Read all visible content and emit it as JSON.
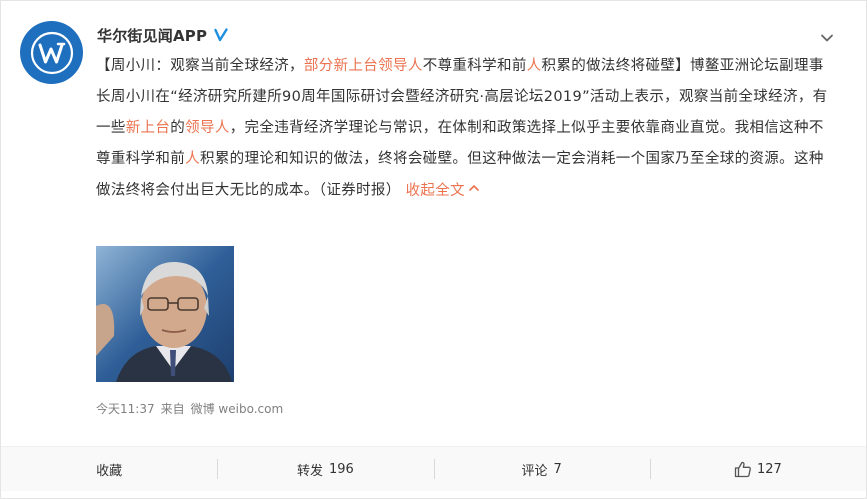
{
  "post": {
    "author": "华尔街见闻APP",
    "text_segments": [
      {
        "text": "【周小川：观察当前全球经济，",
        "highlight": false
      },
      {
        "text": "部分新上台领导人",
        "highlight": true
      },
      {
        "text": "不尊重科学和前",
        "highlight": false
      },
      {
        "text": "人",
        "highlight": true
      },
      {
        "text": "积累的做法终将碰壁】博鳌亚洲论坛副理事长周小川在“经济研究所建所90周年国际研讨会暨经济研究·高层论坛2019”活动上表示，观察当前全球经济，有一些",
        "highlight": false
      },
      {
        "text": "新上台",
        "highlight": true
      },
      {
        "text": "的",
        "highlight": false
      },
      {
        "text": "领导人",
        "highlight": true
      },
      {
        "text": "，完全违背经济学理论与常识，在体制和政策选择上似乎主要依靠商业直觉。我相信这种不尊重科学和前",
        "highlight": false
      },
      {
        "text": "人",
        "highlight": true
      },
      {
        "text": "积累的理论和知识的做法，终将会碰壁。但这种做法一定会消耗一个国家乃至全球的资源。这种做法终将会付出巨大无比的成本。（证券时报）",
        "highlight": false
      }
    ],
    "collapse_label": "收起全文",
    "timestamp": "今天11:37",
    "from_label": "来自",
    "source": "微博 weibo.com"
  },
  "actions": {
    "favorite_label": "收藏",
    "repost_label": "转发",
    "repost_count": "196",
    "comment_label": "评论",
    "comment_count": "7",
    "like_count": "127"
  },
  "colors": {
    "highlight": "#eb7350",
    "avatar_bg": "#1f6fbf",
    "verified": "#f2a31a"
  },
  "icons": {
    "avatar": "wallstreetcn-logo-icon",
    "verified": "verified-badge-icon",
    "more": "chevron-down-icon",
    "collapse": "chevron-up-icon",
    "like": "thumbs-up-icon"
  }
}
